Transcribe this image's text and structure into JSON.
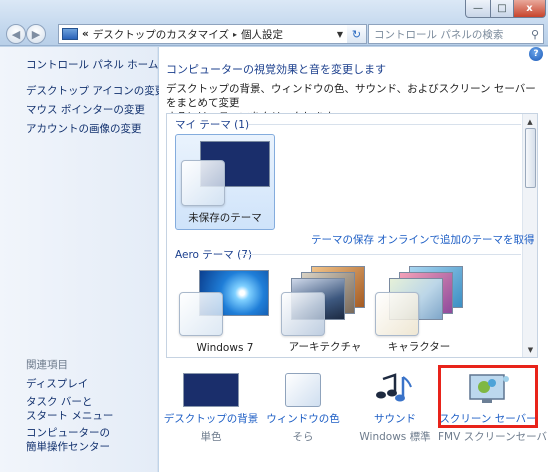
{
  "window": {
    "minimize_glyph": "—",
    "maximize_glyph": "□",
    "close_glyph": "x"
  },
  "nav": {
    "back_glyph": "◀",
    "forward_glyph": "▶",
    "overflow": "«",
    "breadcrumbs": [
      "デスクトップのカスタマイズ",
      "個人設定"
    ],
    "breadcrumb_sep": "▸",
    "dropdown_glyph": "▼",
    "refresh_glyph": "↻",
    "search_placeholder": "コントロール パネルの検索",
    "search_glyph": "⚲"
  },
  "sidebar": {
    "home": "コントロール パネル ホーム",
    "links": [
      "デスクトップ アイコンの変更",
      "マウス ポインターの変更",
      "アカウントの画像の変更"
    ],
    "related_title": "関連項目",
    "related": [
      "ディスプレイ",
      "タスク バーと\nスタート メニュー",
      "コンピューターの\n簡単操作センター"
    ]
  },
  "main": {
    "help_glyph": "?",
    "heading": "コンピューターの視覚効果と音を変更します",
    "description": "デスクトップの背景、ウィンドウの色、サウンド、およびスクリーン セーバーをまとめて変更\nするには、テーマをクリックします。",
    "my_themes_header": "マイ テーマ (1)",
    "unsaved_theme": "未保存のテーマ",
    "save_theme_link": "テーマの保存",
    "online_link": "オンラインで追加のテーマを取得",
    "aero_header": "Aero テーマ (7)",
    "aero_themes": [
      "Windows 7",
      "アーキテクチャ",
      "キャラクター"
    ],
    "scroll_up": "▲",
    "scroll_down": "▼"
  },
  "bottom": {
    "items": [
      {
        "label": "デスクトップの背景",
        "sub": "単色"
      },
      {
        "label": "ウィンドウの色",
        "sub": "そら"
      },
      {
        "label": "サウンド",
        "sub": "Windows 標準"
      },
      {
        "label": "スクリーン セーバー",
        "sub": "FMV スクリーンセーバー"
      }
    ]
  },
  "colors": {
    "solid_background": "#1a2e6b",
    "highlight_box": "#e8231a",
    "link": "#1d5ec5"
  }
}
